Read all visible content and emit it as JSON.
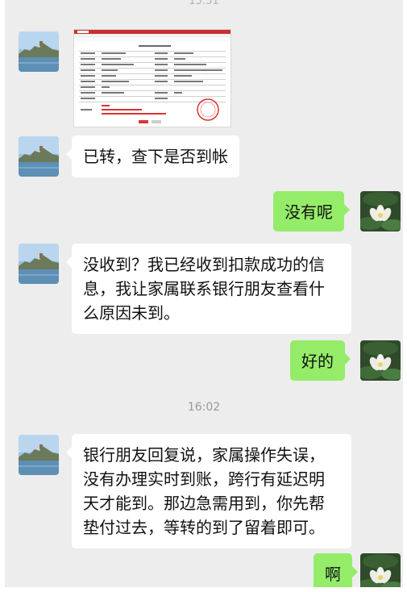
{
  "chat": {
    "top_timestamp": "15:51",
    "mid_timestamp": "16:02",
    "messages": [
      {
        "side": "incoming",
        "type": "image",
        "content": "bank-transfer-receipt-screenshot"
      },
      {
        "side": "incoming",
        "type": "text",
        "text": "已转，查下是否到帐"
      },
      {
        "side": "outgoing",
        "type": "text",
        "text": "没有呢"
      },
      {
        "side": "incoming",
        "type": "text",
        "lines": [
          "没收到？我已经收到扣款成功的信",
          "息，我让家属联系银行朋友查看什",
          "么原因未到。"
        ]
      },
      {
        "side": "outgoing",
        "type": "text",
        "text": "好的"
      },
      {
        "side": "incoming",
        "type": "text",
        "lines": [
          "银行朋友回复说，家属操作失误，",
          "没有办理实时到账，跨行有延迟明",
          "天才能到。那边急需用到，你先帮",
          "垫付过去，等转的到了留着即可。"
        ]
      },
      {
        "side": "outgoing",
        "type": "text",
        "text": "啊"
      }
    ]
  },
  "colors": {
    "background": "#ededed",
    "incoming_bubble": "#ffffff",
    "outgoing_bubble": "#95ec69",
    "timestamp": "#9a9a9a"
  },
  "icons": {
    "contact_avatar": "lake-landscape-avatar",
    "self_avatar": "lotus-flower-avatar"
  }
}
